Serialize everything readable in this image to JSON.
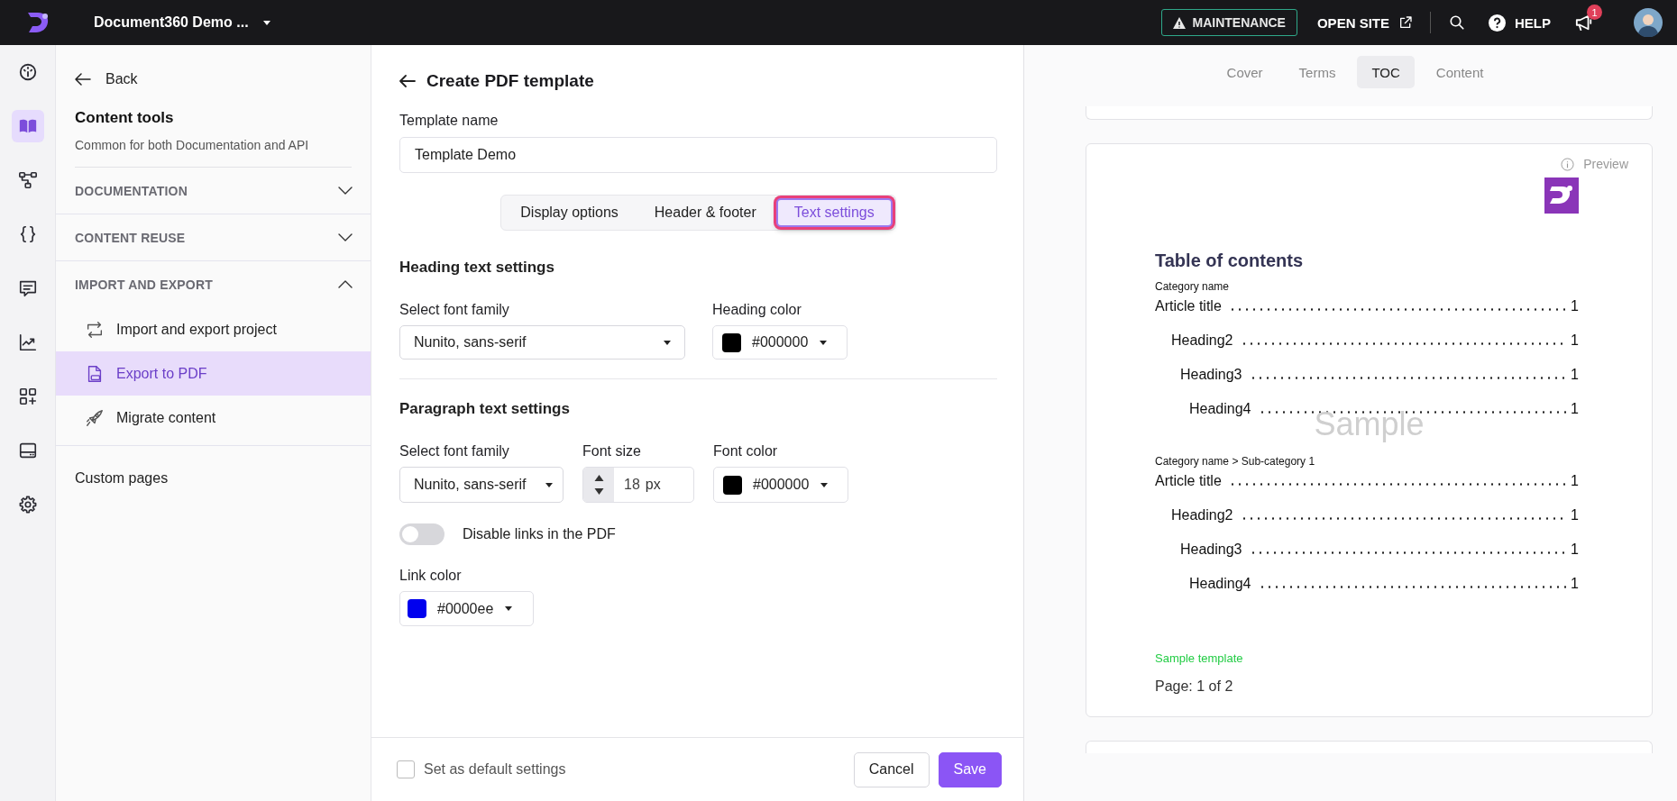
{
  "topbar": {
    "project_name": "Document360 Demo ...",
    "maintenance": "MAINTENANCE",
    "open_site": "OPEN SITE",
    "help": "HELP",
    "notifications": "1"
  },
  "rail": [
    {
      "kind": "dashboard",
      "selected": false
    },
    {
      "kind": "book",
      "selected": true
    },
    {
      "kind": "tree",
      "selected": false
    },
    {
      "kind": "braces",
      "selected": false
    },
    {
      "kind": "chat",
      "selected": false
    },
    {
      "kind": "chart",
      "selected": false
    },
    {
      "kind": "apps",
      "selected": false
    },
    {
      "kind": "drive",
      "selected": false
    },
    {
      "kind": "settings",
      "selected": false
    }
  ],
  "sidebar": {
    "back": "Back",
    "title": "Content tools",
    "subtitle": "Common for both Documentation and API",
    "sections": [
      {
        "label": "DOCUMENTATION",
        "expanded": false
      },
      {
        "label": "CONTENT REUSE",
        "expanded": false
      },
      {
        "label": "IMPORT AND EXPORT",
        "expanded": true,
        "items": [
          {
            "label": "Import and export project",
            "kind": "transfer",
            "selected": false
          },
          {
            "label": "Export to PDF",
            "kind": "pdf",
            "selected": true
          },
          {
            "label": "Migrate content",
            "kind": "rocket",
            "selected": false
          }
        ]
      }
    ],
    "custom_pages": "Custom pages"
  },
  "form": {
    "title": "Create PDF template",
    "template_name_label": "Template name",
    "template_name": "Template Demo",
    "tabs": [
      {
        "label": "Display options",
        "selected": false
      },
      {
        "label": "Header & footer",
        "selected": false
      },
      {
        "label": "Text settings",
        "selected": true
      }
    ],
    "heading": {
      "title": "Heading text settings",
      "font_label": "Select font family",
      "font": "Nunito, sans-serif",
      "color_label": "Heading color",
      "color_value": "#000000",
      "color": "#000000"
    },
    "paragraph": {
      "title": "Paragraph text settings",
      "font_label": "Select font family",
      "font": "Nunito, sans-serif",
      "size_label": "Font size",
      "size": "18",
      "unit": "px",
      "color_label": "Font color",
      "color_value": "#000000",
      "color": "#000000"
    },
    "disable_links": {
      "label": "Disable links in the PDF",
      "on": false
    },
    "link": {
      "label": "Link color",
      "color_value": "#0000ee",
      "color": "#0000ee"
    }
  },
  "footer": {
    "default_settings": {
      "label": "Set as default settings",
      "checked": false
    },
    "cancel": "Cancel",
    "save": "Save"
  },
  "preview": {
    "tabs": [
      {
        "label": "Cover",
        "selected": false
      },
      {
        "label": "Terms",
        "selected": false
      },
      {
        "label": "TOC",
        "selected": true
      },
      {
        "label": "Content",
        "selected": false
      }
    ],
    "preview_label": "Preview",
    "toc_title": "Table of contents",
    "watermark": "Sample",
    "categories": [
      {
        "name": "Category name",
        "entries": [
          {
            "title": "Article title",
            "page": "1",
            "children": [
              {
                "title": "Heading2",
                "page": "1",
                "children": [
                  {
                    "title": "Heading3",
                    "page": "1",
                    "children": [
                      {
                        "title": "Heading4",
                        "page": "1"
                      }
                    ]
                  }
                ]
              }
            ]
          }
        ]
      },
      {
        "name": "Category name > Sub-category 1",
        "entries": [
          {
            "title": "Article title",
            "page": "1",
            "children": [
              {
                "title": "Heading2",
                "page": "1",
                "children": [
                  {
                    "title": "Heading3",
                    "page": "1",
                    "children": [
                      {
                        "title": "Heading4",
                        "page": "1"
                      }
                    ]
                  }
                ]
              }
            ]
          }
        ]
      }
    ],
    "footer_text": "Sample template",
    "page_text": "Page: 1 of 2"
  }
}
